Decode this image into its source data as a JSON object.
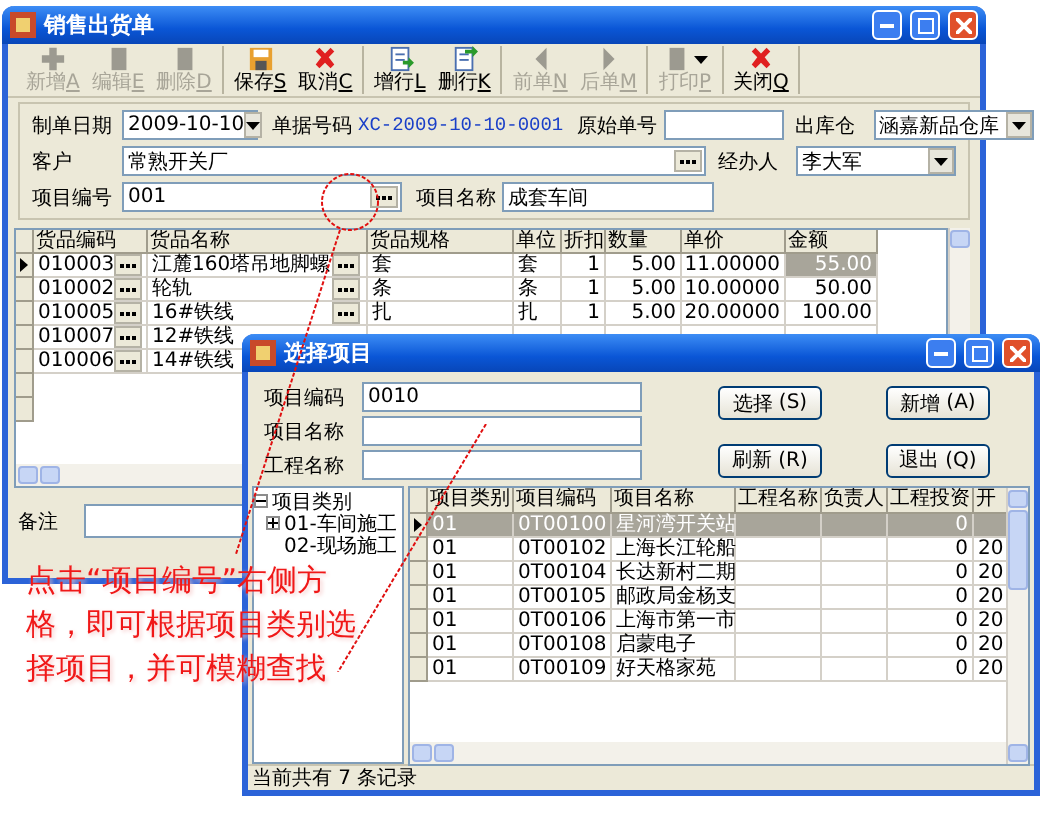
{
  "main_window": {
    "title": "销售出货单",
    "toolbar": [
      [
        {
          "label": "新增",
          "key": "A",
          "kind": "plus",
          "disabled": true
        },
        {
          "label": "编辑",
          "key": "E",
          "kind": "doc",
          "disabled": true
        },
        {
          "label": "删除",
          "key": "D",
          "kind": "doc",
          "disabled": true
        }
      ],
      [
        {
          "label": "保存",
          "key": "S",
          "kind": "save",
          "disabled": false
        },
        {
          "label": "取消",
          "key": "C",
          "kind": "cancel",
          "disabled": false
        }
      ],
      [
        {
          "label": "增行",
          "key": "L",
          "kind": "addrow",
          "disabled": false
        },
        {
          "label": "删行",
          "key": "K",
          "kind": "delrow",
          "disabled": false
        }
      ],
      [
        {
          "label": "前单",
          "key": "N",
          "kind": "prev",
          "disabled": true
        },
        {
          "label": "后单",
          "key": "M",
          "kind": "next",
          "disabled": true
        }
      ],
      [
        {
          "label": "打印",
          "key": "P",
          "kind": "print",
          "disabled": true
        }
      ],
      [
        {
          "label": "关闭",
          "key": "Q",
          "kind": "cancel",
          "disabled": false
        }
      ]
    ],
    "form": {
      "date_label": "制单日期",
      "date": "2009-10-10",
      "number_label": "单据号码",
      "number": "XC-2009-10-10-0001",
      "orig_label": "原始单号",
      "warehouse_label": "出库仓",
      "warehouse": "涵嘉新品仓库",
      "customer_label": "客户",
      "customer": "常熟开关厂",
      "handler_label": "经办人",
      "handler": "李大军",
      "project_code_label": "项目编号",
      "project_code": "001",
      "project_name_label": "项目名称",
      "project_name": "成套车间"
    },
    "grid": {
      "columns": [
        "货品编码",
        "货品名称",
        "货品规格",
        "单位",
        "折扣",
        "数量",
        "单价",
        "金额"
      ],
      "rows": [
        {
          "selected": true,
          "cells": [
            "010003",
            "江麓160塔吊地脚螺",
            "套",
            "套",
            "1",
            "5.00",
            "11.00000",
            "55.00"
          ]
        },
        {
          "selected": false,
          "cells": [
            "010002",
            "轮轨",
            "条",
            "条",
            "1",
            "5.00",
            "10.00000",
            "50.00"
          ]
        },
        {
          "selected": false,
          "cells": [
            "010005",
            "16#铁线",
            "扎",
            "扎",
            "1",
            "5.00",
            "20.00000",
            "100.00"
          ]
        },
        {
          "selected": false,
          "cells": [
            "010007",
            "12#铁线"
          ]
        },
        {
          "selected": false,
          "cells": [
            "010006",
            "14#铁线"
          ]
        }
      ]
    },
    "remark_label": "备注"
  },
  "dialog": {
    "title": "选择项目",
    "fields": [
      {
        "label": "项目编码",
        "value": "0010"
      },
      {
        "label": "项目名称"
      },
      {
        "label": "工程名称"
      }
    ],
    "buttons": [
      {
        "label": "选择",
        "key": "(S)"
      },
      {
        "label": "新增",
        "key": "(A)"
      },
      {
        "label": "刷新",
        "key": "(R)"
      },
      {
        "label": "退出",
        "key": "(Q)"
      }
    ],
    "tree": {
      "label": "项目类别",
      "kind": "folder",
      "expanded": true,
      "children": [
        {
          "label": "01-车间施工",
          "kind": "folder",
          "expanded": false
        },
        {
          "label": "02-现场施工",
          "kind": "leaf"
        }
      ]
    },
    "grid": {
      "columns": [
        "项目类别",
        "项目编码",
        "项目名称",
        "工程名称",
        "负责人",
        "工程投资",
        "开"
      ],
      "rows": [
        {
          "selected": true,
          "cells": [
            "01",
            "0T00100",
            "星河湾开关站",
            null,
            null,
            "0",
            null
          ]
        },
        {
          "selected": false,
          "cells": [
            "01",
            "0T00102",
            "上海长江轮船",
            null,
            null,
            "0",
            "20"
          ]
        },
        {
          "selected": false,
          "cells": [
            "01",
            "0T00104",
            "长达新村二期",
            null,
            null,
            "0",
            "20"
          ]
        },
        {
          "selected": false,
          "cells": [
            "01",
            "0T00105",
            "邮政局金杨支",
            null,
            null,
            "0",
            "20"
          ]
        },
        {
          "selected": false,
          "cells": [
            "01",
            "0T00106",
            "上海市第一市",
            null,
            null,
            "0",
            "20"
          ]
        },
        {
          "selected": false,
          "cells": [
            "01",
            "0T00108",
            "启蒙电子",
            null,
            null,
            "0",
            "20"
          ]
        },
        {
          "selected": false,
          "cells": [
            "01",
            "0T00109",
            "好天格家苑",
            null,
            null,
            "0",
            "20"
          ]
        }
      ]
    },
    "status": "当前共有 7 条记录"
  },
  "annotation": "点击“项目编号”右侧方格，即可根据项目类别选择项目，并可模糊查找"
}
